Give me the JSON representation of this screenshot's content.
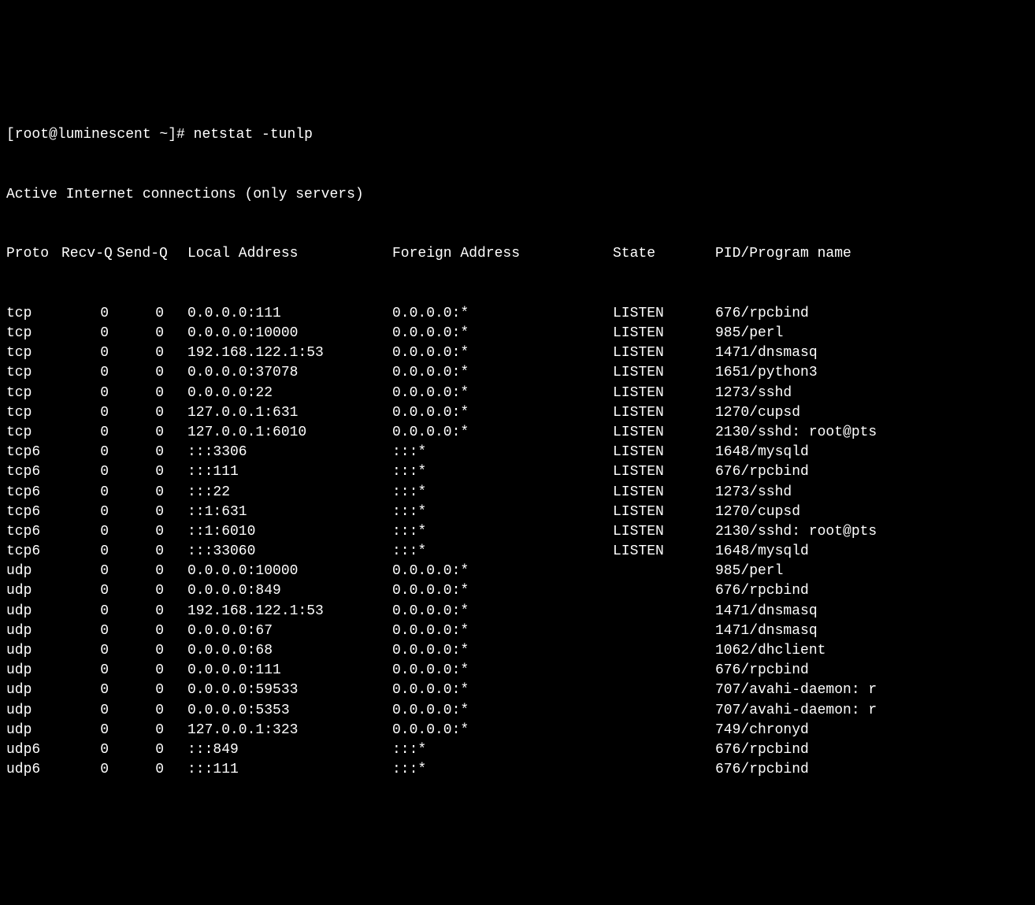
{
  "prompt": "[root@luminescent ~]# ",
  "command": "netstat -tunlp",
  "subtitle": "Active Internet connections (only servers)",
  "headers": {
    "proto": "Proto",
    "recvq": "Recv-Q",
    "sendq": "Send-Q",
    "local": "Local Address",
    "foreign": "Foreign Address",
    "state": "State",
    "pid": "PID/Program name"
  },
  "rows": [
    {
      "proto": "tcp",
      "recvq": "0",
      "sendq": "0",
      "local": "0.0.0.0:111",
      "foreign": "0.0.0.0:*",
      "state": "LISTEN",
      "pid": "676/rpcbind"
    },
    {
      "proto": "tcp",
      "recvq": "0",
      "sendq": "0",
      "local": "0.0.0.0:10000",
      "foreign": "0.0.0.0:*",
      "state": "LISTEN",
      "pid": "985/perl"
    },
    {
      "proto": "tcp",
      "recvq": "0",
      "sendq": "0",
      "local": "192.168.122.1:53",
      "foreign": "0.0.0.0:*",
      "state": "LISTEN",
      "pid": "1471/dnsmasq"
    },
    {
      "proto": "tcp",
      "recvq": "0",
      "sendq": "0",
      "local": "0.0.0.0:37078",
      "foreign": "0.0.0.0:*",
      "state": "LISTEN",
      "pid": "1651/python3"
    },
    {
      "proto": "tcp",
      "recvq": "0",
      "sendq": "0",
      "local": "0.0.0.0:22",
      "foreign": "0.0.0.0:*",
      "state": "LISTEN",
      "pid": "1273/sshd"
    },
    {
      "proto": "tcp",
      "recvq": "0",
      "sendq": "0",
      "local": "127.0.0.1:631",
      "foreign": "0.0.0.0:*",
      "state": "LISTEN",
      "pid": "1270/cupsd"
    },
    {
      "proto": "tcp",
      "recvq": "0",
      "sendq": "0",
      "local": "127.0.0.1:6010",
      "foreign": "0.0.0.0:*",
      "state": "LISTEN",
      "pid": "2130/sshd: root@pts"
    },
    {
      "proto": "tcp6",
      "recvq": "0",
      "sendq": "0",
      "local": ":::3306",
      "foreign": ":::*",
      "state": "LISTEN",
      "pid": "1648/mysqld"
    },
    {
      "proto": "tcp6",
      "recvq": "0",
      "sendq": "0",
      "local": ":::111",
      "foreign": ":::*",
      "state": "LISTEN",
      "pid": "676/rpcbind"
    },
    {
      "proto": "tcp6",
      "recvq": "0",
      "sendq": "0",
      "local": ":::22",
      "foreign": ":::*",
      "state": "LISTEN",
      "pid": "1273/sshd"
    },
    {
      "proto": "tcp6",
      "recvq": "0",
      "sendq": "0",
      "local": "::1:631",
      "foreign": ":::*",
      "state": "LISTEN",
      "pid": "1270/cupsd"
    },
    {
      "proto": "tcp6",
      "recvq": "0",
      "sendq": "0",
      "local": "::1:6010",
      "foreign": ":::*",
      "state": "LISTEN",
      "pid": "2130/sshd: root@pts"
    },
    {
      "proto": "tcp6",
      "recvq": "0",
      "sendq": "0",
      "local": ":::33060",
      "foreign": ":::*",
      "state": "LISTEN",
      "pid": "1648/mysqld"
    },
    {
      "proto": "udp",
      "recvq": "0",
      "sendq": "0",
      "local": "0.0.0.0:10000",
      "foreign": "0.0.0.0:*",
      "state": "",
      "pid": "985/perl"
    },
    {
      "proto": "udp",
      "recvq": "0",
      "sendq": "0",
      "local": "0.0.0.0:849",
      "foreign": "0.0.0.0:*",
      "state": "",
      "pid": "676/rpcbind"
    },
    {
      "proto": "udp",
      "recvq": "0",
      "sendq": "0",
      "local": "192.168.122.1:53",
      "foreign": "0.0.0.0:*",
      "state": "",
      "pid": "1471/dnsmasq"
    },
    {
      "proto": "udp",
      "recvq": "0",
      "sendq": "0",
      "local": "0.0.0.0:67",
      "foreign": "0.0.0.0:*",
      "state": "",
      "pid": "1471/dnsmasq"
    },
    {
      "proto": "udp",
      "recvq": "0",
      "sendq": "0",
      "local": "0.0.0.0:68",
      "foreign": "0.0.0.0:*",
      "state": "",
      "pid": "1062/dhclient"
    },
    {
      "proto": "udp",
      "recvq": "0",
      "sendq": "0",
      "local": "0.0.0.0:111",
      "foreign": "0.0.0.0:*",
      "state": "",
      "pid": "676/rpcbind"
    },
    {
      "proto": "udp",
      "recvq": "0",
      "sendq": "0",
      "local": "0.0.0.0:59533",
      "foreign": "0.0.0.0:*",
      "state": "",
      "pid": "707/avahi-daemon: r"
    },
    {
      "proto": "udp",
      "recvq": "0",
      "sendq": "0",
      "local": "0.0.0.0:5353",
      "foreign": "0.0.0.0:*",
      "state": "",
      "pid": "707/avahi-daemon: r"
    },
    {
      "proto": "udp",
      "recvq": "0",
      "sendq": "0",
      "local": "127.0.0.1:323",
      "foreign": "0.0.0.0:*",
      "state": "",
      "pid": "749/chronyd"
    },
    {
      "proto": "udp6",
      "recvq": "0",
      "sendq": "0",
      "local": ":::849",
      "foreign": ":::*",
      "state": "",
      "pid": "676/rpcbind"
    },
    {
      "proto": "udp6",
      "recvq": "0",
      "sendq": "0",
      "local": ":::111",
      "foreign": ":::*",
      "state": "",
      "pid": "676/rpcbind"
    }
  ]
}
